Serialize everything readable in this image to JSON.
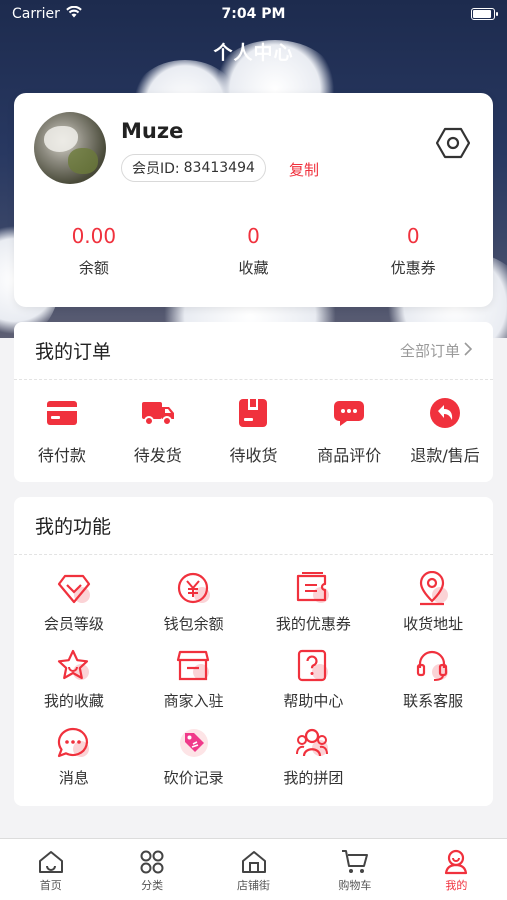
{
  "status_bar": {
    "carrier": "Carrier",
    "time": "7:04 PM"
  },
  "nav": {
    "title": "个人中心"
  },
  "profile": {
    "username": "Muze",
    "member_id_label": "会员ID:",
    "member_id": "83413494",
    "copy_label": "复制",
    "stats": [
      {
        "value": "0.00",
        "label": "余额"
      },
      {
        "value": "0",
        "label": "收藏"
      },
      {
        "value": "0",
        "label": "优惠券"
      }
    ]
  },
  "orders": {
    "title": "我的订单",
    "all_label": "全部订单",
    "items": [
      {
        "label": "待付款",
        "icon": "card-icon"
      },
      {
        "label": "待发货",
        "icon": "truck-icon"
      },
      {
        "label": "待收货",
        "icon": "package-icon"
      },
      {
        "label": "商品评价",
        "icon": "comment-icon"
      },
      {
        "label": "退款/售后",
        "icon": "return-icon"
      }
    ]
  },
  "functions": {
    "title": "我的功能",
    "items": [
      {
        "label": "会员等级",
        "icon": "diamond-icon"
      },
      {
        "label": "钱包余额",
        "icon": "yuan-coin-icon"
      },
      {
        "label": "我的优惠券",
        "icon": "coupon-icon"
      },
      {
        "label": "收货地址",
        "icon": "location-pin-icon"
      },
      {
        "label": "我的收藏",
        "icon": "star-icon"
      },
      {
        "label": "商家入驻",
        "icon": "store-icon"
      },
      {
        "label": "帮助中心",
        "icon": "question-icon"
      },
      {
        "label": "联系客服",
        "icon": "headset-icon"
      },
      {
        "label": "消息",
        "icon": "chat-bubble-icon"
      },
      {
        "label": "砍价记录",
        "icon": "price-tag-icon"
      },
      {
        "label": "我的拼团",
        "icon": "group-icon"
      }
    ]
  },
  "tabbar": {
    "items": [
      {
        "label": "首页",
        "icon": "home-icon",
        "active": false
      },
      {
        "label": "分类",
        "icon": "grid-icon",
        "active": false
      },
      {
        "label": "店铺街",
        "icon": "shop-street-icon",
        "active": false
      },
      {
        "label": "购物车",
        "icon": "cart-icon",
        "active": false
      },
      {
        "label": "我的",
        "icon": "profile-icon",
        "active": true
      }
    ]
  },
  "colors": {
    "accent": "#f0313d",
    "header_bg": "#1d2b4e",
    "page_bg": "#f3f3f5"
  }
}
